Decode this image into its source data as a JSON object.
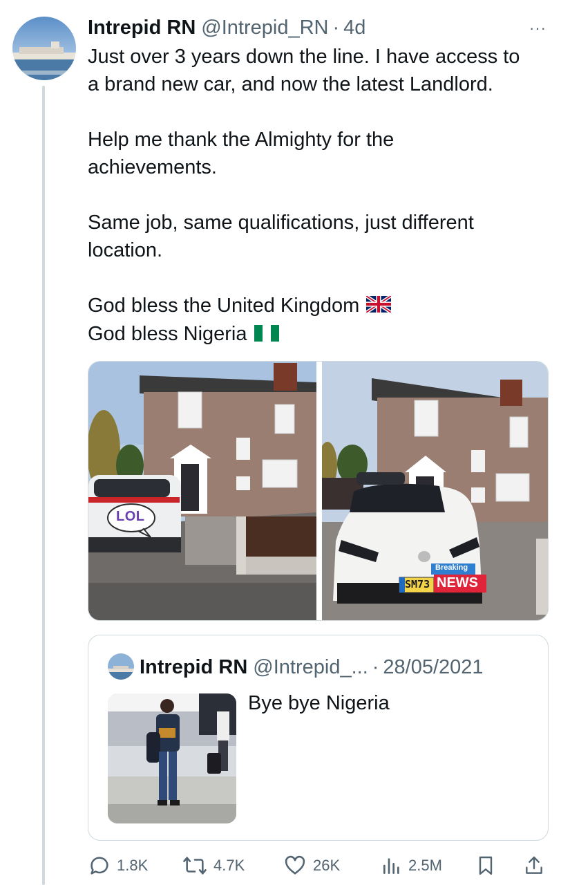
{
  "tweet": {
    "author_name": "Intrepid RN",
    "author_handle": "@Intrepid_RN",
    "separator": "·",
    "time": "4d",
    "more_label": "···",
    "paragraphs": [
      [
        "Just over 3 years down the line. I have access to",
        "a brand new car, and now the latest Landlord."
      ],
      [
        "Help me thank the Almighty for the",
        "achievements."
      ],
      [
        "Same job, same qualifications, just different",
        "location."
      ],
      [
        "God bless the United Kingdom",
        "God bless Nigeria"
      ]
    ],
    "flags": [
      "uk-flag-icon",
      "nigeria-flag-icon"
    ],
    "photos": {
      "left_sticker": "LOL",
      "right_plate": "SM73",
      "right_badge_top": "Breaking",
      "right_badge_bottom": "NEWS"
    }
  },
  "quote": {
    "author_name": "Intrepid RN",
    "author_handle": "@Intrepid_...",
    "separator": "·",
    "date": "28/05/2021",
    "text": "Bye bye Nigeria"
  },
  "actions": {
    "replies": "1.8K",
    "reposts": "4.7K",
    "likes": "26K",
    "views": "2.5M"
  },
  "colors": {
    "text": "#0f1419",
    "secondary": "#536471",
    "border": "#cfd9de",
    "flag_green": "#008751",
    "news_red": "#e0243a"
  }
}
